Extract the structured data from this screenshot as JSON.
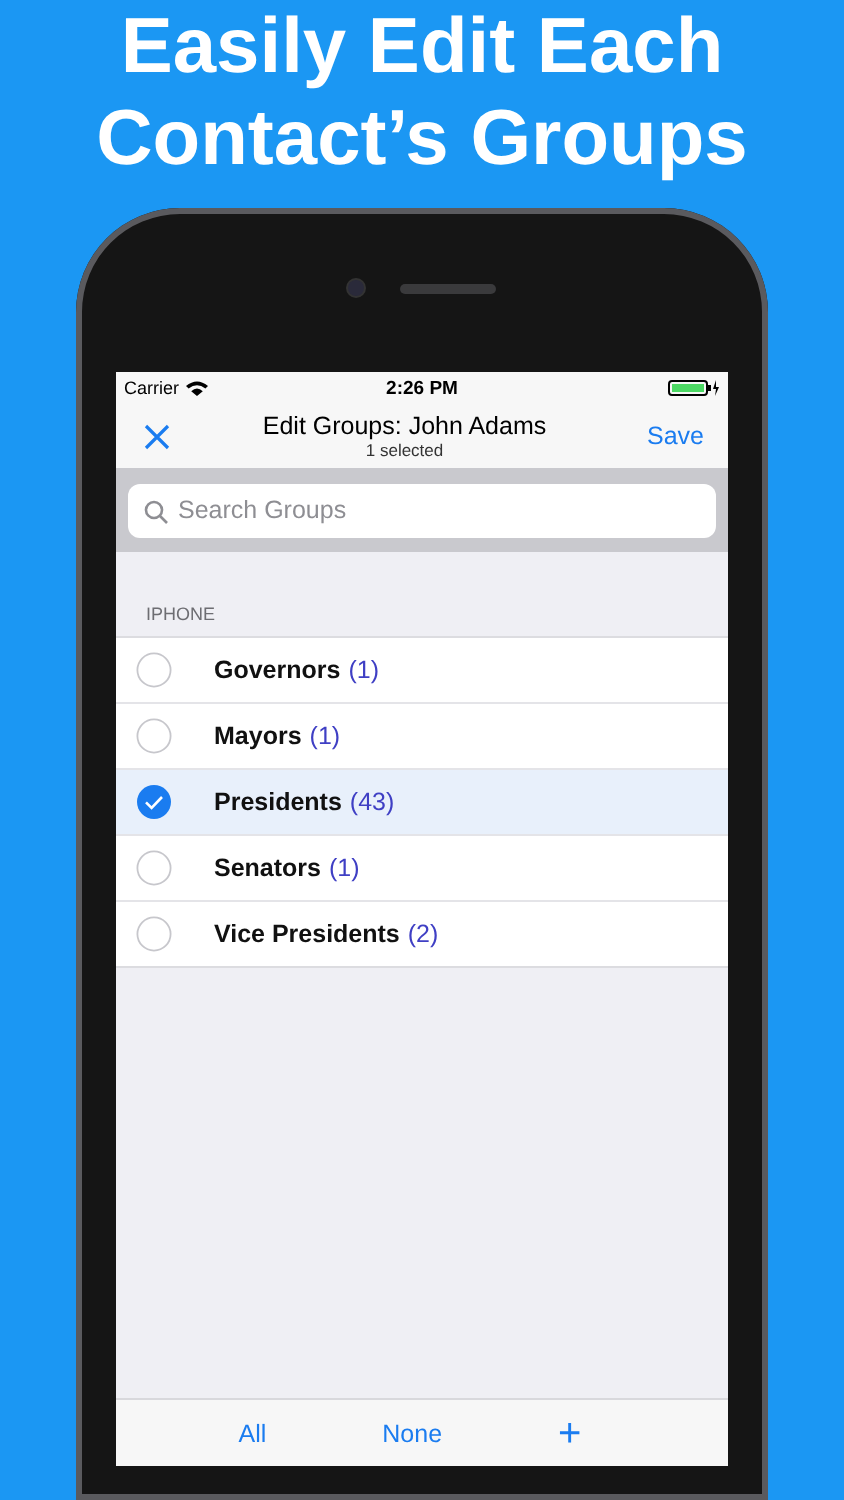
{
  "headline": "Easily Edit Each Contact’s Groups",
  "status_bar": {
    "carrier": "Carrier",
    "time": "2:26 PM"
  },
  "nav": {
    "title": "Edit Groups: John Adams",
    "subtitle": "1 selected",
    "save": "Save"
  },
  "search": {
    "placeholder": "Search Groups"
  },
  "section": "IPHONE",
  "groups": [
    {
      "name": "Governors",
      "count": "(1)",
      "selected": false
    },
    {
      "name": "Mayors",
      "count": "(1)",
      "selected": false
    },
    {
      "name": "Presidents",
      "count": "(43)",
      "selected": true
    },
    {
      "name": "Senators",
      "count": "(1)",
      "selected": false
    },
    {
      "name": "Vice Presidents",
      "count": "(2)",
      "selected": false
    }
  ],
  "toolbar": {
    "all": "All",
    "none": "None",
    "add": "+"
  }
}
